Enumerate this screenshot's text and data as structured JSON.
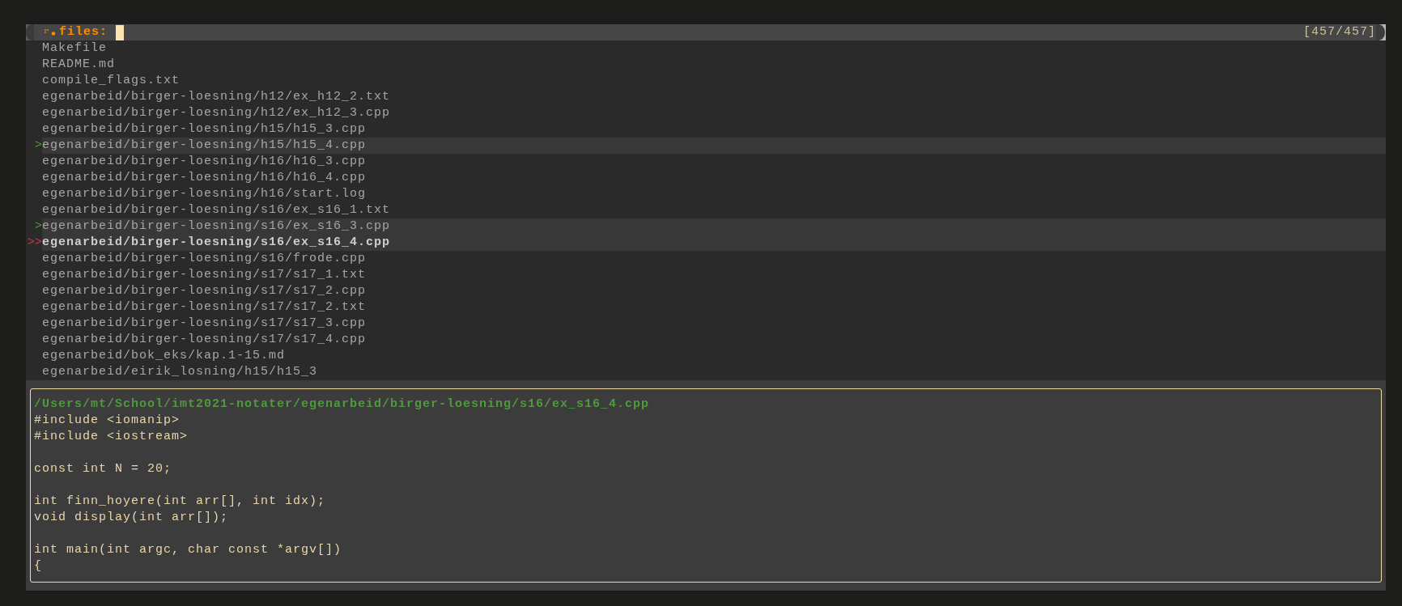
{
  "prompt": {
    "label": "files:",
    "counter": "[457/457]"
  },
  "files": {
    "items": [
      {
        "path": "Makefile",
        "selected": false,
        "current": false
      },
      {
        "path": "README.md",
        "selected": false,
        "current": false
      },
      {
        "path": "compile_flags.txt",
        "selected": false,
        "current": false
      },
      {
        "path": "egenarbeid/birger-loesning/h12/ex_h12_2.txt",
        "selected": false,
        "current": false
      },
      {
        "path": "egenarbeid/birger-loesning/h12/ex_h12_3.cpp",
        "selected": false,
        "current": false
      },
      {
        "path": "egenarbeid/birger-loesning/h15/h15_3.cpp",
        "selected": false,
        "current": false
      },
      {
        "path": "egenarbeid/birger-loesning/h15/h15_4.cpp",
        "selected": true,
        "current": false,
        "marker": ">"
      },
      {
        "path": "egenarbeid/birger-loesning/h16/h16_3.cpp",
        "selected": false,
        "current": false
      },
      {
        "path": "egenarbeid/birger-loesning/h16/h16_4.cpp",
        "selected": false,
        "current": false
      },
      {
        "path": "egenarbeid/birger-loesning/h16/start.log",
        "selected": false,
        "current": false
      },
      {
        "path": "egenarbeid/birger-loesning/s16/ex_s16_1.txt",
        "selected": false,
        "current": false
      },
      {
        "path": "egenarbeid/birger-loesning/s16/ex_s16_3.cpp",
        "selected": true,
        "current": false,
        "marker": ">"
      },
      {
        "path": "egenarbeid/birger-loesning/s16/ex_s16_4.cpp",
        "selected": true,
        "current": true,
        "marker": ">>"
      },
      {
        "path": "egenarbeid/birger-loesning/s16/frode.cpp",
        "selected": false,
        "current": false
      },
      {
        "path": "egenarbeid/birger-loesning/s17/s17_1.txt",
        "selected": false,
        "current": false
      },
      {
        "path": "egenarbeid/birger-loesning/s17/s17_2.cpp",
        "selected": false,
        "current": false
      },
      {
        "path": "egenarbeid/birger-loesning/s17/s17_2.txt",
        "selected": false,
        "current": false
      },
      {
        "path": "egenarbeid/birger-loesning/s17/s17_3.cpp",
        "selected": false,
        "current": false
      },
      {
        "path": "egenarbeid/birger-loesning/s17/s17_4.cpp",
        "selected": false,
        "current": false
      },
      {
        "path": "egenarbeid/bok_eks/kap.1-15.md",
        "selected": false,
        "current": false
      },
      {
        "path": "egenarbeid/eirik_losning/h15/h15_3",
        "selected": false,
        "current": false
      }
    ]
  },
  "preview": {
    "path": "/Users/mt/School/imt2021-notater/egenarbeid/birger-loesning/s16/ex_s16_4.cpp",
    "blocks": [
      [
        "#include <iomanip>",
        "#include <iostream>"
      ],
      [
        "const int N = 20;"
      ],
      [
        "int finn_hoyere(int arr[], int idx);",
        "void display(int arr[]);"
      ],
      [
        "int main(int argc, char const *argv[])",
        "{"
      ]
    ]
  }
}
